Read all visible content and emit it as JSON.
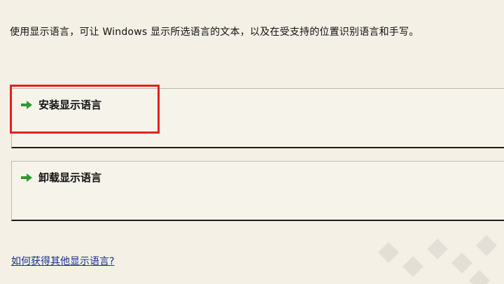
{
  "description": "使用显示语言，可让 Windows 显示所选语言的文本，以及在受支持的位置识别语言和手写。",
  "options": [
    {
      "label": "安装显示语言",
      "icon": "green-arrow-icon"
    },
    {
      "label": "卸载显示语言",
      "icon": "green-arrow-icon"
    }
  ],
  "help_link": "如何获得其他显示语言?",
  "colors": {
    "background": "#f4f0e6",
    "arrow": "#2e9a2e",
    "highlight": "#e0231c",
    "link": "#1b2e8a"
  }
}
